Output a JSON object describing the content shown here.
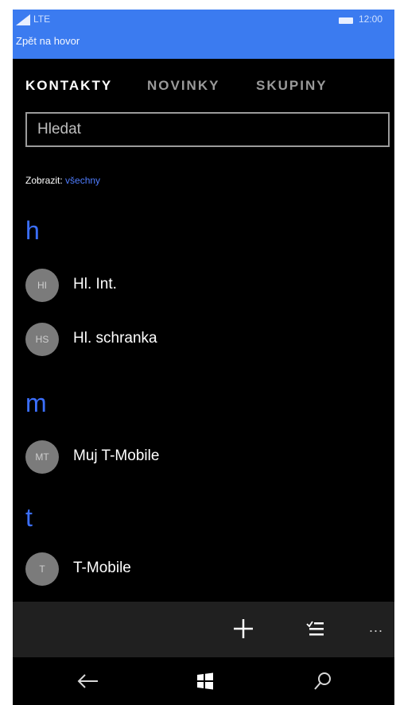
{
  "status": {
    "network": "LTE",
    "time": "12:00",
    "call_banner": "Zpět na hovor"
  },
  "tabs": [
    {
      "label": "KONTAKTY",
      "active": true
    },
    {
      "label": "NOVINKY",
      "active": false
    },
    {
      "label": "SKUPINY",
      "active": false
    }
  ],
  "search": {
    "placeholder": "Hledat"
  },
  "filter": {
    "label": "Zobrazit:",
    "value": "všechny"
  },
  "groups": [
    {
      "letter": "h",
      "contacts": [
        {
          "initials": "HI",
          "name": "Hl. Int."
        },
        {
          "initials": "HS",
          "name": "Hl. schranka"
        }
      ]
    },
    {
      "letter": "m",
      "contacts": [
        {
          "initials": "MT",
          "name": "Muj T-Mobile"
        }
      ]
    },
    {
      "letter": "t",
      "contacts": [
        {
          "initials": "T",
          "name": "T-Mobile"
        }
      ]
    }
  ],
  "appbar": {
    "more": "..."
  },
  "icons": [
    "signal-icon",
    "battery-icon",
    "add-icon",
    "select-list-icon",
    "more-icon",
    "back-arrow-icon",
    "windows-start-icon",
    "search-icon"
  ],
  "colors": {
    "accent": "#3b6fff",
    "banner": "#3b7bf0",
    "link": "#4f7dff"
  }
}
